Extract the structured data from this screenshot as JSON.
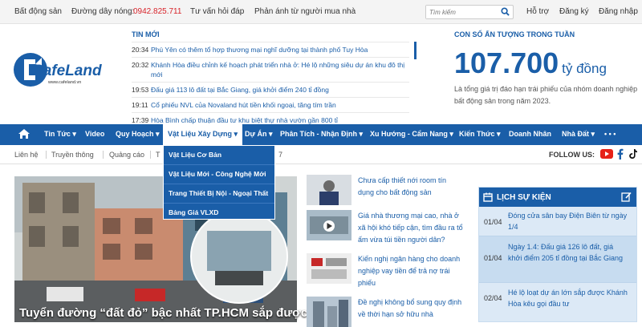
{
  "topbar": {
    "links": [
      "Bất động sản",
      "Đường dây nóng:",
      "Tư vấn hỏi đáp",
      "Phản ánh từ người mua nhà"
    ],
    "hotline": "0942.825.711",
    "search_placeholder": "Tìm kiếm",
    "right_links": [
      "Hỗ trợ",
      "Đăng ký",
      "Đăng nhập"
    ]
  },
  "logo": {
    "name": "CafeLand",
    "url_text": "www.cafeland.vn"
  },
  "news": {
    "heading": "TIN MỚI",
    "items": [
      {
        "time": "20:34",
        "title": "Phú Yên có thêm tổ hợp thương mại nghĩ dưỡng tại thành phố Tuy Hòa"
      },
      {
        "time": "20:32",
        "title": "Khánh Hòa điều chỉnh kế hoạch phát triển nhà ở: Hé lộ những siêu dự án khu đô thị mới"
      },
      {
        "time": "19:53",
        "title": "Đấu giá 113 lô đất tại Bắc Giang, giá khởi điểm 240 tỉ đồng"
      },
      {
        "time": "19:11",
        "title": "Cổ phiếu NVL của Novaland hút tiền khối ngoại, tăng tím trần"
      },
      {
        "time": "17:39",
        "title": "Hòa Bình chấp thuận đầu tư khu biệt thự nhà vườn gần 800 tỉ"
      }
    ]
  },
  "stat": {
    "heading": "CON SỐ ẤN TƯỢNG TRONG TUẦN",
    "value": "107.700",
    "unit": "tỷ đồng",
    "description": "Là tổng giá trị đáo hạn trái phiếu của nhóm doanh nghiệp bất động sản trong năm 2023."
  },
  "nav": {
    "items": [
      "Tin Tức ▾",
      "Video",
      "Quy Hoạch ▾",
      "Vật Liệu Xây Dựng ▾",
      "Dự Án ▾",
      "Phân Tích - Nhận Định ▾",
      "Xu Hướng - Cẩm Nang ▾",
      "Kiến Thức ▾",
      "Doanh Nhân",
      "Nhà Đất ▾",
      "• • •"
    ],
    "dropdown": [
      "Vật Liệu Cơ Bản",
      "Vật Liệu Mới - Công Nghệ Mới",
      "Trang Thiết Bị Nội - Ngoại Thất",
      "Bảng Giá VLXD"
    ]
  },
  "subnav": {
    "items": [
      "Liên hệ",
      "Truyền thông",
      "Quảng cáo",
      "T"
    ],
    "trailing": "7",
    "follow": "FOLLOW US:"
  },
  "hero": {
    "caption": "Tuyển đường “đất đỏ” bậc nhất TP.HCM sắp được"
  },
  "mid_news": [
    "Chưa cấp thiết nới room tín dụng cho bất động sản",
    "Giá nhà thương mại cao, nhà ở xã hội khó tiếp cận, tìm đầu ra tổ ấm vừa túi tiền người dân?",
    "Kiến nghị ngân hàng cho doanh nghiệp vay tiền để trả nợ trái phiếu",
    "Đề nghị không bổ sung quy định về thời hạn sở hữu nhà"
  ],
  "events": {
    "heading": "LỊCH SỰ KIỆN",
    "items": [
      {
        "date": "01/04",
        "title": "Đóng cửa sân bay Điện Biên từ ngày 1/4"
      },
      {
        "date": "01/04",
        "title": "Ngày 1.4: Đấu giá 126 lô đất, giá khởi điểm 205 tỉ đồng tại Bắc Giang"
      },
      {
        "date": "02/04",
        "title": "Hé lộ loạt dự án lớn sắp được Khánh Hòa kêu gọi đầu tư"
      }
    ]
  },
  "colors": {
    "brand": "#1a5ea8",
    "hotline": "#d8232a"
  }
}
